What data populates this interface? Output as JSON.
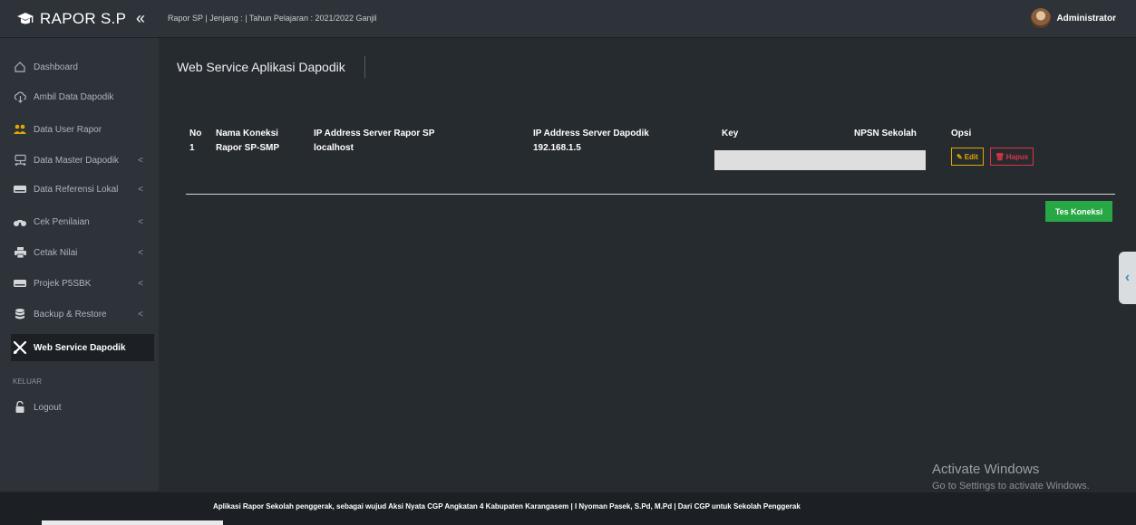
{
  "app": {
    "name": "RAPOR S.P"
  },
  "header": {
    "breadcrumb": "Rapor SP | Jenjang : | Tahun Pelajaran : 2021/2022 Ganjil",
    "user_name": "Administrator",
    "icons": {
      "brand": "graduation-icon",
      "collapse": "double-chevron-left-icon",
      "avatar": "user-avatar"
    }
  },
  "sidebar": {
    "items": [
      {
        "label": "Dashboard",
        "icon": "home-icon",
        "has_chevron": false
      },
      {
        "label": "Ambil Data Dapodik",
        "icon": "cloud-download-icon",
        "has_chevron": false
      },
      {
        "label": "Data User Rapor",
        "icon": "users-icon",
        "has_chevron": false
      },
      {
        "label": "Data Master Dapodik",
        "icon": "network-icon",
        "has_chevron": true
      },
      {
        "label": "Data Referensi Lokal",
        "icon": "drive-icon",
        "has_chevron": true
      },
      {
        "label": "Cek Penilaian",
        "icon": "binoculars-icon",
        "has_chevron": true
      },
      {
        "label": "Cetak Nilai",
        "icon": "print-icon",
        "has_chevron": true
      },
      {
        "label": "Projek P5SBK",
        "icon": "drive-icon",
        "has_chevron": true
      },
      {
        "label": "Backup & Restore",
        "icon": "database-icon",
        "has_chevron": true
      },
      {
        "label": "Web Service Dapodik",
        "icon": "tools-icon",
        "has_chevron": false,
        "active": true
      }
    ],
    "section_label": "KELUAR",
    "logout_label": "Logout",
    "chevron": "<"
  },
  "main": {
    "title": "Web Service Aplikasi Dapodik",
    "table": {
      "headers": [
        "No",
        "Nama Koneksi",
        "IP Address Server Rapor SP",
        "IP Address Server Dapodik",
        "Key",
        "NPSN Sekolah",
        "Opsi"
      ],
      "rows": [
        {
          "no": "1",
          "nama": "Rapor SP-SMP",
          "ip_rapor": "localhost",
          "ip_dapodik": "192.168.1.5",
          "key": "",
          "npsn": ""
        }
      ]
    },
    "edit_label": "Edit",
    "delete_label": "Hapus",
    "test_label": "Tes Koneksi"
  },
  "watermark": {
    "title": "Activate Windows",
    "subtitle": "Go to Settings to activate Windows."
  },
  "footer": {
    "text": "Aplikasi Rapor Sekolah penggerak, sebagai wujud Aksi Nyata CGP Angkatan 4 Kabupaten Karangasem | I Nyoman Pasek, S.Pd, M.Pd | Dari CGP untuk Sekolah Penggerak"
  },
  "colors": {
    "success": "#28a745",
    "warning": "#e0a800",
    "danger": "#dc3545",
    "background": "#262b30",
    "sidebar": "#2d3338"
  }
}
